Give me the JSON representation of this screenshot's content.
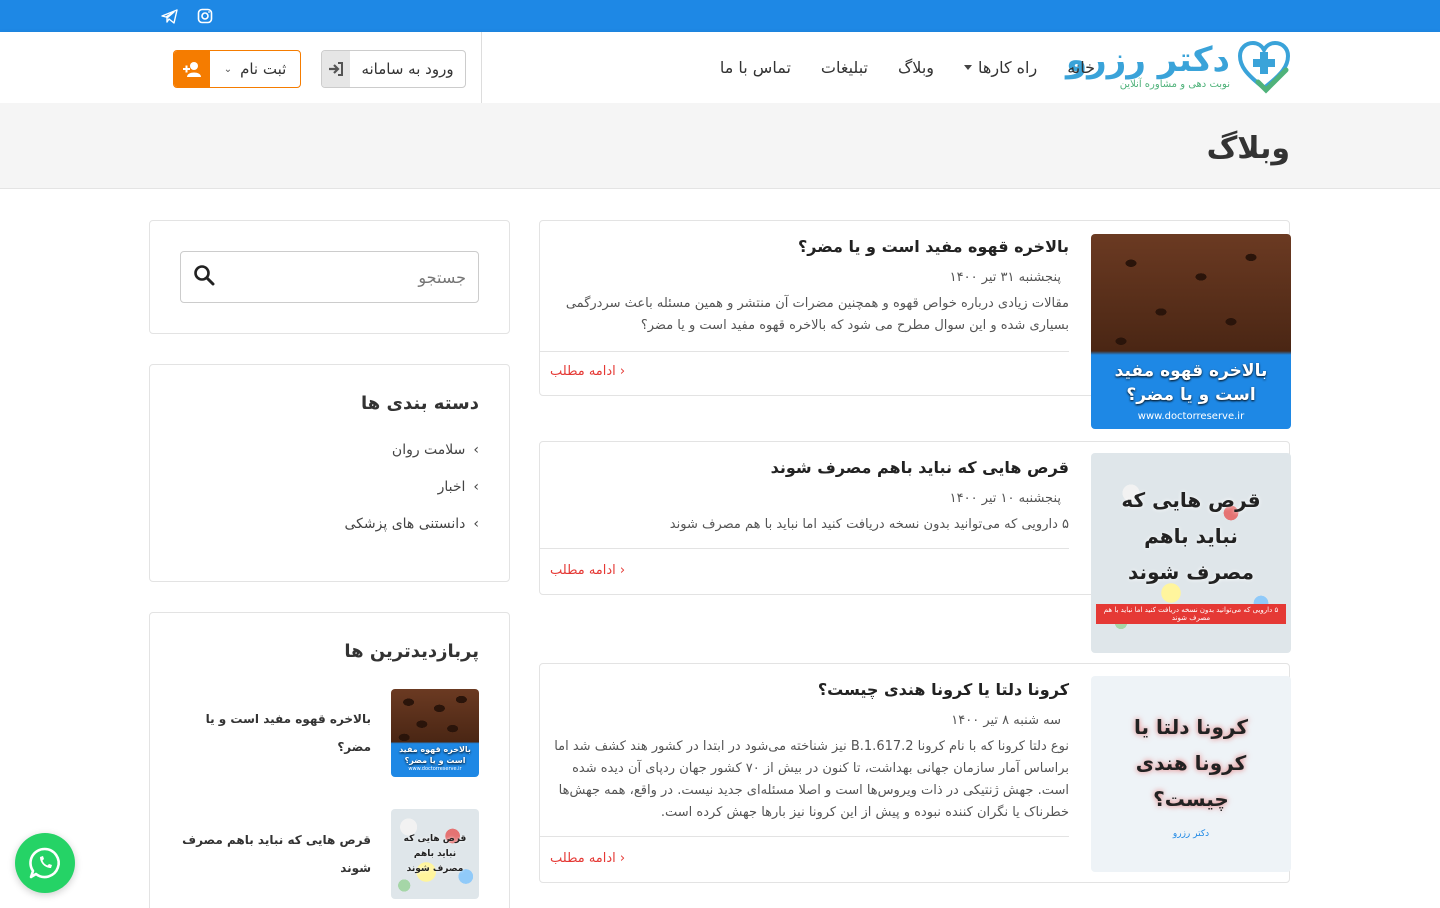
{
  "social": {
    "items": [
      {
        "icon": "instagram-icon"
      },
      {
        "icon": "telegram-icon"
      }
    ]
  },
  "brand": {
    "name": "دکتر رزرو",
    "tagline": "نوبت دهی و مشاوره آنلاین",
    "colors": {
      "primary": "#1e88e5",
      "accent": "#f57c00",
      "green": "#4fb27a"
    }
  },
  "nav": {
    "home": "خانه",
    "guides": "راه کارها",
    "blog": "وبلاگ",
    "ads": "تبلیغات",
    "contact": "تماس با ما"
  },
  "auth": {
    "login": "ورود به سامانه",
    "register": "ثبت نام"
  },
  "page": {
    "title": "وبلاگ"
  },
  "posts": [
    {
      "title": "بالاخره قهوه مفید است و یا مضر؟",
      "date": "پنجشنبه ۳۱ تیر ۱۴۰۰",
      "excerpt": "مقالات زیادی درباره خواص قهوه و همچنین مضرات آن منتشر و همین مسئله باعث سردرگمی بسیاری شده و این سوال مطرح می شود که بالاخره قهوه مفید است و یا مضر؟",
      "more": "ادامه مطلب",
      "thumb_text": "بالاخره قهوه مفید است و یا مضر؟",
      "thumb_url": "www.doctorreserve.ir"
    },
    {
      "title": "قرص هایی که نباید باهم مصرف شوند",
      "date": "پنجشنبه ۱۰ تیر ۱۴۰۰",
      "excerpt": "۵ دارویی که می‌توانید بدون نسخه دریافت کنید اما نباید با هم مصرف شوند",
      "more": "ادامه مطلب",
      "thumb_text": "قرص هایی که نباید باهم مصرف شوند",
      "thumb_caption": "۵ دارویی که می‌توانید بدون نسخه دریافت کنید اما نباید با هم مصرف شوند"
    },
    {
      "title": "کرونا دلتا یا کرونا هندی چیست؟",
      "date": "سه شنبه ۸ تیر ۱۴۰۰",
      "excerpt": "نوع دلتا کرونا که با نام کرونا B.1.617.2 نیز شناخته می‌شود در ابتدا در کشور هند کشف شد اما براساس آمار سازمان جهانی بهداشت، تا کنون در بیش از ۷۰ کشور جهان ردپای آن دیده شده است. جهش ژنتیکی در ذات ویروس‌ها است و اصلا مسئله‌ای جدید نیست. در واقع، همه جهش‌ها خطرناک یا نگران کننده نبوده و پیش از این کرونا نیز بارها جهش کرده است.",
      "more": "ادامه مطلب",
      "thumb_text": "کرونا دلتا یا کرونا هندی چیست؟",
      "thumb_brand": "دکتر رزرو"
    }
  ],
  "sidebar": {
    "search_placeholder": "جستجو",
    "categories_title": "دسته بندی ها",
    "categories": [
      "سلامت روان",
      "اخبار",
      "دانستنی های پزشکی"
    ],
    "popular_title": "پربازدیدترین ها",
    "popular": [
      {
        "title": "بالاخره قهوه مفید است و یا مضر؟",
        "thumb_text": "بالاخره قهوه مفید است و یا مضر؟",
        "thumb_url": "www.doctorreserve.ir"
      },
      {
        "title": "قرص هایی که نباید باهم مصرف شوند",
        "thumb_text": "قرص هایی که نباید باهم مصرف شوند"
      }
    ]
  }
}
